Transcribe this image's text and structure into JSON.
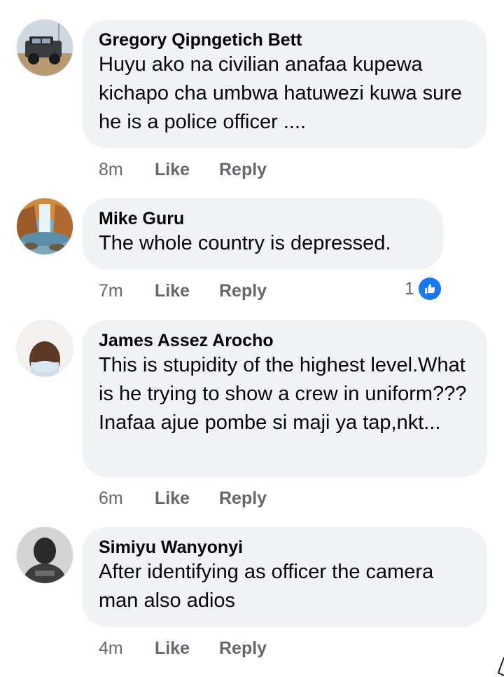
{
  "comments": [
    {
      "author": "Gregory Qipngetich Bett",
      "text": "Huyu ako na civilian anafaa kupewa kichapo cha umbwa hatuwezi kuwa sure he is a police officer ....",
      "time": "8m",
      "like_label": "Like",
      "reply_label": "Reply"
    },
    {
      "author": "Mike Guru",
      "text": "The whole country is depressed.",
      "time": "7m",
      "like_label": "Like",
      "reply_label": "Reply",
      "reaction_count": "1",
      "reaction_icon": "like-icon"
    },
    {
      "author": "James Assez Arocho",
      "text": "This is stupidity of the highest level.What is he trying to show a crew in uniform??? Inafaa ajue pombe si maji ya tap,nkt...",
      "time": "6m",
      "like_label": "Like",
      "reply_label": "Reply"
    },
    {
      "author": "Simiyu Wanyonyi",
      "text": "After identifying as officer the camera man also adios",
      "time": "4m",
      "like_label": "Like",
      "reply_label": "Reply"
    }
  ],
  "colors": {
    "bubble": "#f0f2f5",
    "meta_text": "#65676b",
    "like_blue": "#1877f2"
  }
}
